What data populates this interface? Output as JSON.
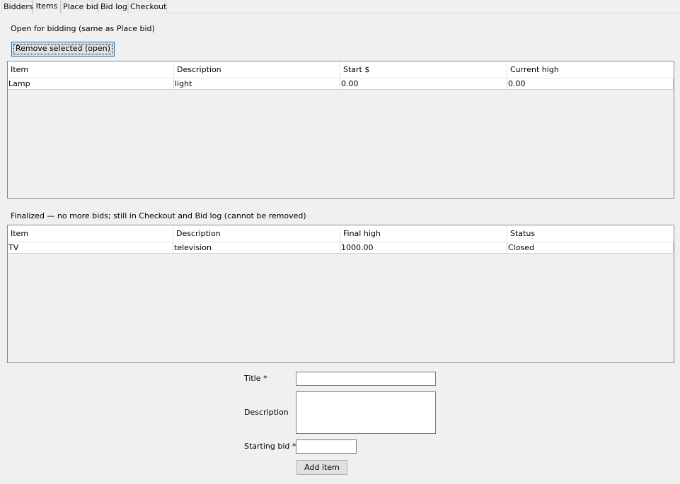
{
  "tabs": [
    {
      "label": "Bidders"
    },
    {
      "label": "Items"
    },
    {
      "label": "Place bid"
    },
    {
      "label": "Bid log"
    },
    {
      "label": "Checkout"
    }
  ],
  "open_section": {
    "title": "Open for bidding (same as Place bid)",
    "remove_button": "Remove selected (open)",
    "columns": [
      "Item",
      "Description",
      "Start $",
      "Current high"
    ],
    "rows": [
      [
        "Lamp",
        "light",
        "0.00",
        "0.00"
      ]
    ]
  },
  "finalized_section": {
    "title": "Finalized — no more bids; still in Checkout and Bid log (cannot be removed)",
    "columns": [
      "Item",
      "Description",
      "Final high",
      "Status"
    ],
    "rows": [
      [
        "TV",
        "television",
        "1000.00",
        "Closed"
      ]
    ]
  },
  "form": {
    "title_label": "Title *",
    "title_value": "",
    "description_label": "Description",
    "description_value": "",
    "starting_bid_label": "Starting bid *",
    "starting_bid_value": "",
    "add_button": "Add item"
  }
}
